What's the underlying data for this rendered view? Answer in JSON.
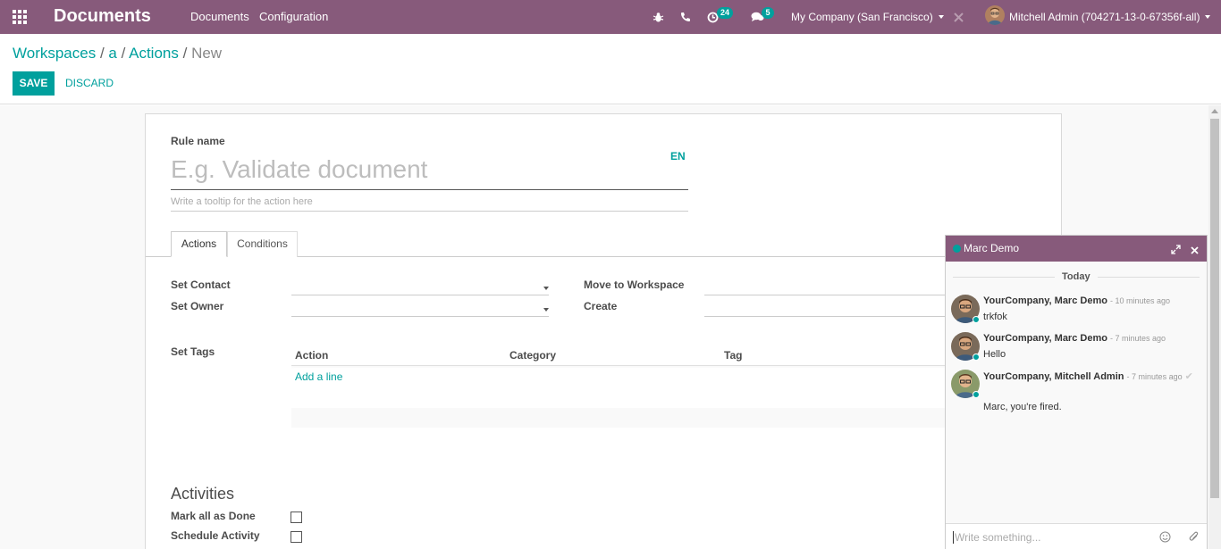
{
  "navbar": {
    "app_title": "Documents",
    "menu": [
      "Documents",
      "Configuration"
    ],
    "activity_count": "24",
    "message_count": "5",
    "company": "My Company (San Francisco)",
    "user": "Mitchell Admin (704271-13-0-67356f-all)"
  },
  "breadcrumb": [
    "Workspaces",
    "a",
    "Actions",
    "New"
  ],
  "buttons": {
    "save": "SAVE",
    "discard": "DISCARD"
  },
  "form": {
    "rule_name_label": "Rule name",
    "rule_name_placeholder": "E.g. Validate document",
    "tooltip_placeholder": "Write a tooltip for the action here",
    "lang": "EN",
    "tabs": [
      "Actions",
      "Conditions"
    ],
    "fields": {
      "set_contact": "Set Contact",
      "set_owner": "Set Owner",
      "move_to_workspace": "Move to Workspace",
      "create": "Create",
      "set_tags": "Set Tags"
    },
    "tags_table": {
      "columns": [
        "Action",
        "Category",
        "Tag"
      ],
      "add_line": "Add a line"
    },
    "activities": {
      "title": "Activities",
      "mark_all_done": "Mark all as Done",
      "schedule_activity": "Schedule Activity"
    }
  },
  "chat": {
    "title": "Marc Demo",
    "date_separator": "Today",
    "messages": [
      {
        "author": "YourCompany, Marc Demo",
        "time": "- 10 minutes ago",
        "text": "trkfok"
      },
      {
        "author": "YourCompany, Marc Demo",
        "time": "- 7 minutes ago",
        "text": "Hello"
      },
      {
        "author": "YourCompany, Mitchell Admin",
        "time": "- 7 minutes ago",
        "text": "Marc, you're fired."
      }
    ],
    "composer_placeholder": "Write something..."
  },
  "colors": {
    "brand": "#875a7b",
    "accent": "#00a09d"
  }
}
